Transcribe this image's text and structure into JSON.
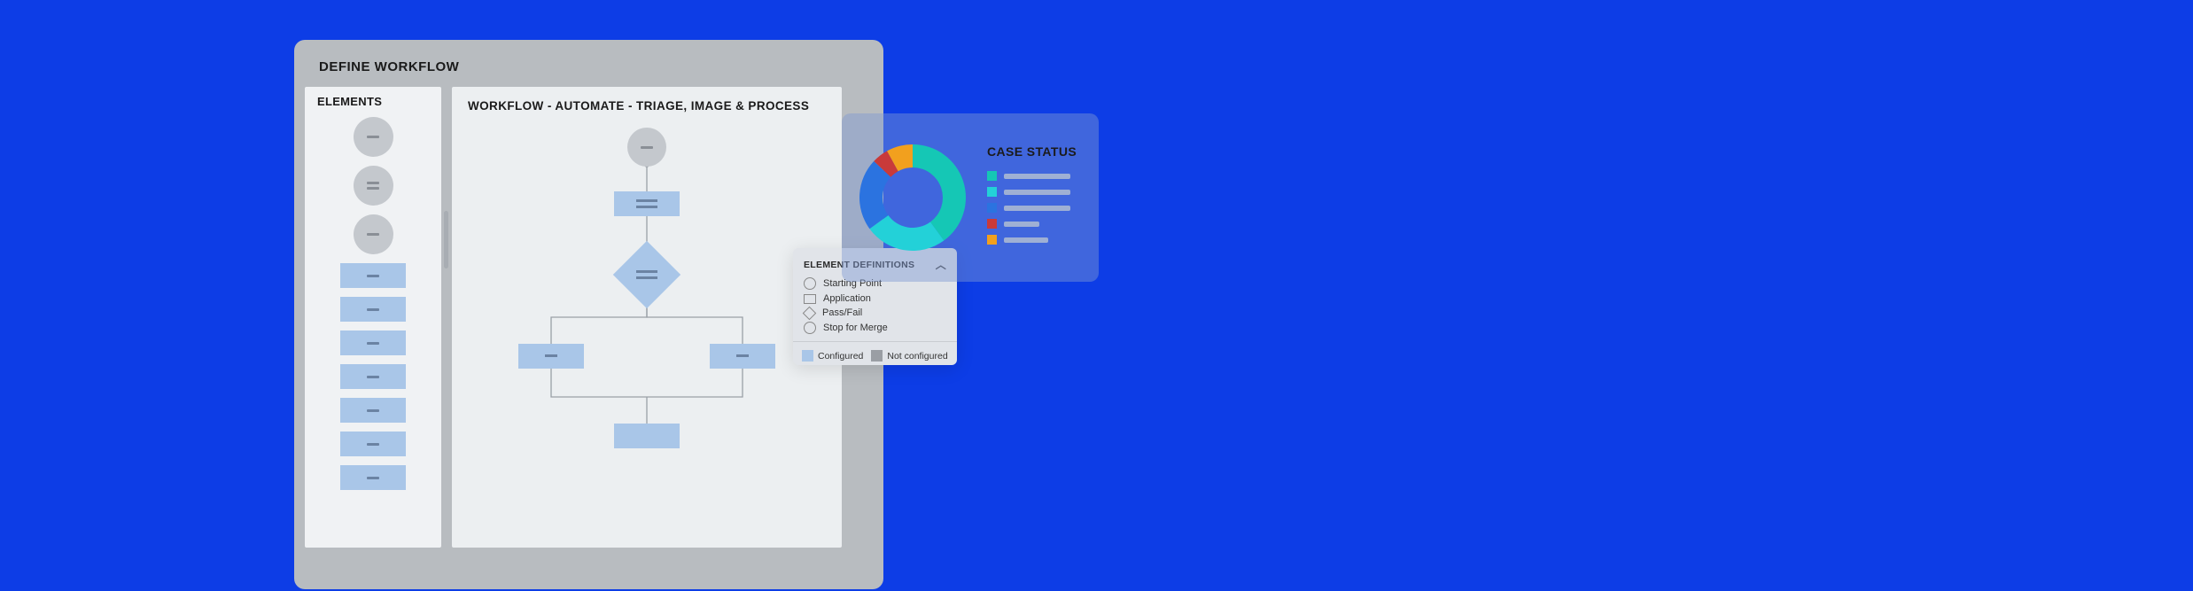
{
  "workflow": {
    "window_title": "DEFINE WORKFLOW",
    "elements_title": "ELEMENTS",
    "canvas_title": "WORKFLOW - AUTOMATE - TRIAGE, IMAGE & PROCESS"
  },
  "definitions": {
    "title": "ELEMENT DEFINITIONS",
    "items": [
      {
        "label": "Starting Point",
        "shape": "circle"
      },
      {
        "label": "Application",
        "shape": "rect"
      },
      {
        "label": "Pass/Fail",
        "shape": "diamond"
      },
      {
        "label": "Stop for Merge",
        "shape": "circle"
      }
    ],
    "configured_label": "Configured",
    "not_configured_label": "Not configured"
  },
  "status": {
    "title": "CASE STATUS"
  },
  "chart_data": {
    "type": "pie",
    "title": "CASE STATUS",
    "series": [
      {
        "name": "teal",
        "value": 40,
        "color": "#15c7b5"
      },
      {
        "name": "cyan",
        "value": 25,
        "color": "#23d1d8"
      },
      {
        "name": "blue",
        "value": 22,
        "color": "#2b73e0"
      },
      {
        "name": "red",
        "value": 5,
        "color": "#c93a3a"
      },
      {
        "name": "orange",
        "value": 8,
        "color": "#f2a01e"
      }
    ],
    "donut": true
  }
}
